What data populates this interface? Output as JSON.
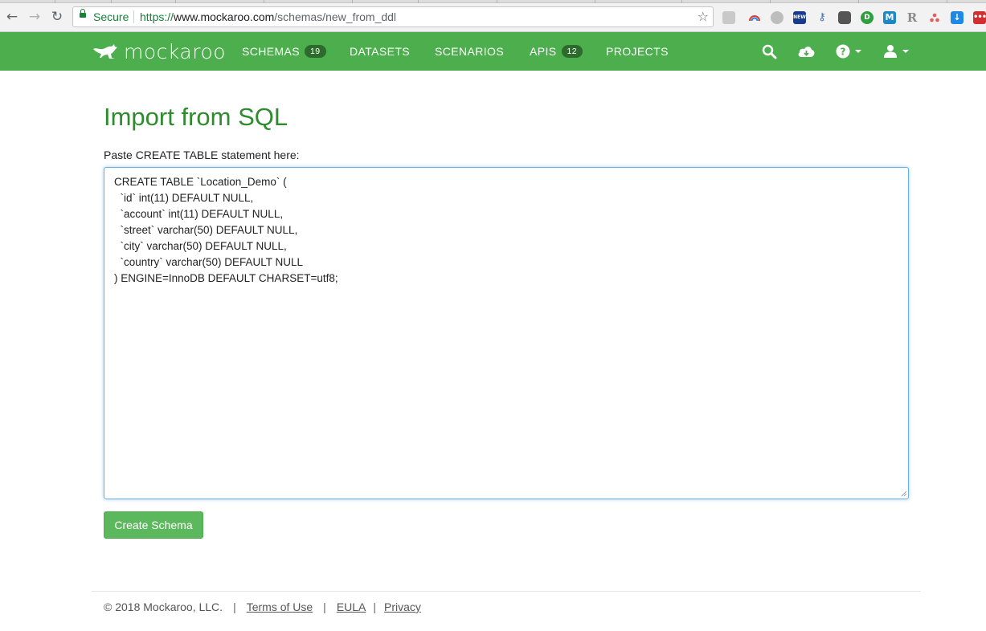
{
  "browser": {
    "secure_label": "Secure",
    "url_scheme": "https://",
    "url_host": "www.mockaroo.com",
    "url_path": "/schemas/new_from_ddl",
    "extensions": [
      {
        "icon": "stack-icon",
        "color": "#bdbdbd"
      },
      {
        "icon": "rainbow-icon",
        "color": "#e53935"
      },
      {
        "icon": "circle-icon",
        "color": "#9e9e9e"
      },
      {
        "icon": "new-badge-icon",
        "color": "#1a3a8a"
      },
      {
        "icon": "key-icon",
        "color": "#3b6db3"
      },
      {
        "icon": "evernote-icon",
        "color": "#555555"
      },
      {
        "icon": "d-circle-icon",
        "color": "#2e9e3e"
      },
      {
        "icon": "m-square-icon",
        "color": "#1e88c7"
      },
      {
        "icon": "r-letter-icon",
        "color": "#8a8a8a"
      },
      {
        "icon": "dots-triangle-icon",
        "color": "#e65a5a"
      },
      {
        "icon": "download-arrow-icon",
        "color": "#1e88e5"
      },
      {
        "icon": "menu-dots-icon",
        "color": "#d32f2f"
      }
    ],
    "extension_letters": {
      "m": "M",
      "r": "R",
      "d": "D",
      "new": "NEW"
    }
  },
  "navbar": {
    "brand": "mockaroo",
    "items": [
      {
        "label": "SCHEMAS",
        "badge": "19"
      },
      {
        "label": "DATASETS",
        "badge": ""
      },
      {
        "label": "SCENARIOS",
        "badge": ""
      },
      {
        "label": "APIS",
        "badge": "12"
      },
      {
        "label": "PROJECTS",
        "badge": ""
      }
    ],
    "icons": [
      "search-icon",
      "cloud-download-icon",
      "help-icon",
      "user-icon"
    ]
  },
  "main": {
    "title": "Import from SQL",
    "label": "Paste CREATE TABLE statement here:",
    "ddl": "CREATE TABLE `Location_Demo` (\n  `id` int(11) DEFAULT NULL,\n  `account` int(11) DEFAULT NULL,\n  `street` varchar(50) DEFAULT NULL,\n  `city` varchar(50) DEFAULT NULL,\n  `country` varchar(50) DEFAULT NULL\n) ENGINE=InnoDB DEFAULT CHARSET=utf8;",
    "create_button": "Create Schema"
  },
  "footer": {
    "copyright": "© 2018 Mockaroo, LLC.",
    "links": [
      "Terms of Use",
      "EULA",
      "Privacy"
    ],
    "separator": "|"
  },
  "colors": {
    "navbar": "#4cae4c",
    "title": "#2e8b2e",
    "button": "#5cb85c",
    "focus": "#66afe9"
  }
}
